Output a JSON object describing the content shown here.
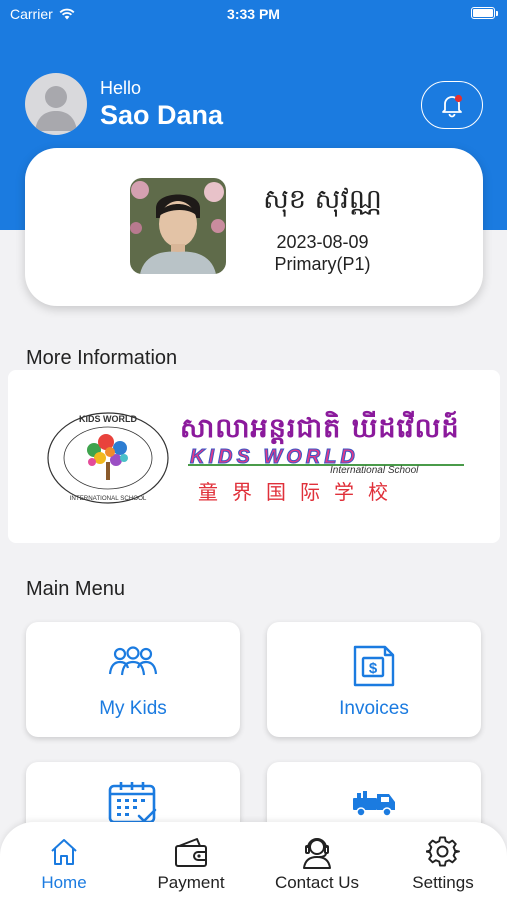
{
  "status_bar": {
    "carrier": "Carrier",
    "time": "3:33 PM"
  },
  "header": {
    "greeting": "Hello",
    "user_name": "Sao Dana"
  },
  "student": {
    "name": "សុខ សុវណ្ណ",
    "date": "2023-08-09",
    "level": "Primary(P1)"
  },
  "more_info": {
    "title": "More Information",
    "logo": {
      "khmer_text": "សាលាអន្តរជាតិ ឃីដវើលដ៍",
      "english_text": "KIDS WORLD",
      "sub_text": "International School",
      "chinese_text": "童界国际学校",
      "ring_top": "KIDS WORLD",
      "ring_bottom": "INTERNATIONAL SCHOOL"
    }
  },
  "main_menu": {
    "title": "Main Menu",
    "items": [
      {
        "label": "My Kids",
        "icon": "group-icon"
      },
      {
        "label": "Invoices",
        "icon": "invoice-icon"
      },
      {
        "label": "",
        "icon": "calendar-icon"
      },
      {
        "label": "",
        "icon": "truck-icon"
      }
    ]
  },
  "bottom_nav": {
    "items": [
      {
        "label": "Home",
        "icon": "home-icon",
        "active": true
      },
      {
        "label": "Payment",
        "icon": "wallet-icon"
      },
      {
        "label": "Contact Us",
        "icon": "support-icon"
      },
      {
        "label": "Settings",
        "icon": "gear-icon"
      }
    ]
  },
  "colors": {
    "primary": "#1b7be0",
    "background": "#f2f2f4",
    "notification_dot": "#e5302f"
  }
}
